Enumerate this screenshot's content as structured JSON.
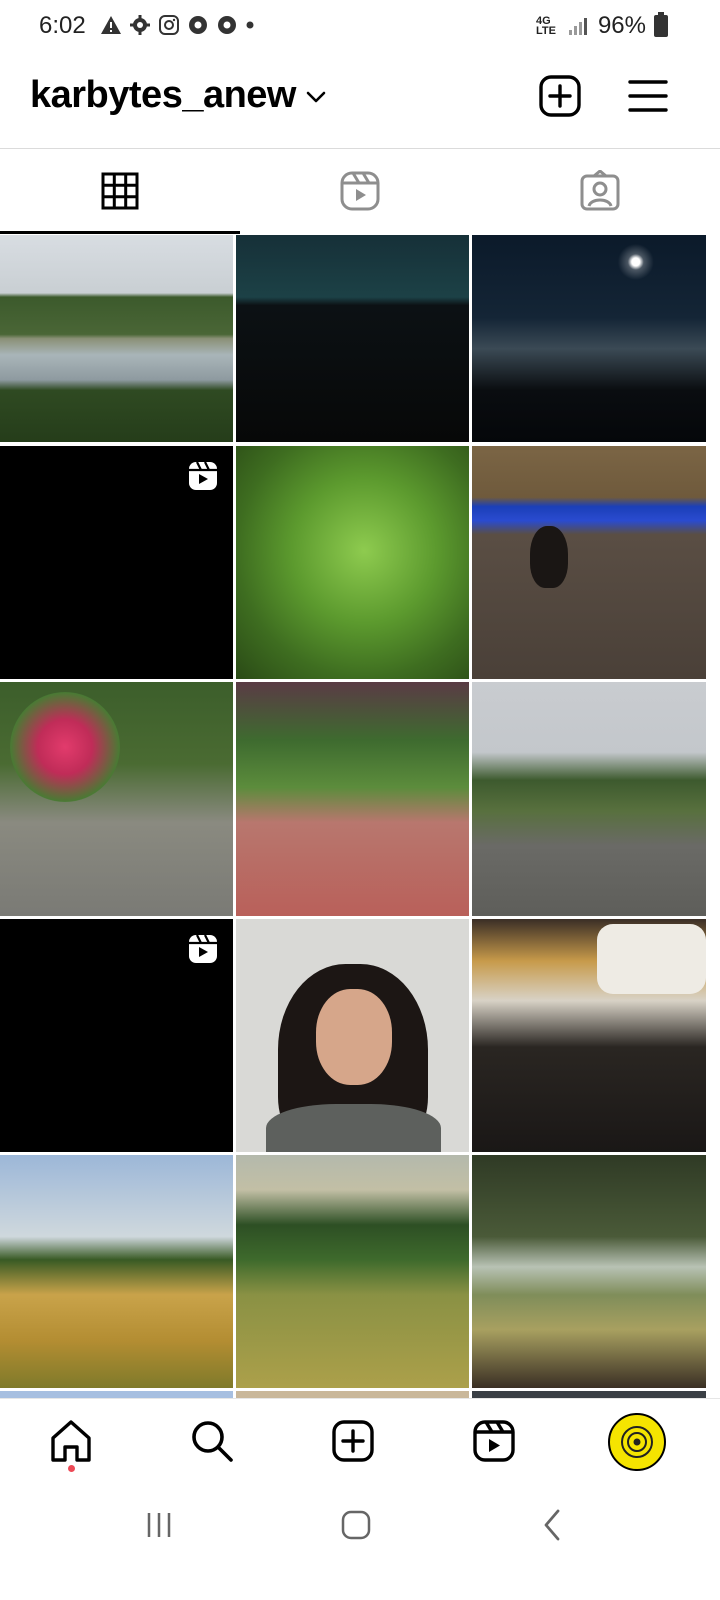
{
  "status_bar": {
    "time": "6:02",
    "network": "4G LTE",
    "battery": "96%",
    "icons": [
      "alert-icon",
      "settings-icon",
      "instagram-icon",
      "chrome-icon",
      "chrome-icon",
      "dot-icon"
    ]
  },
  "header": {
    "username": "karbytes_anew",
    "actions": [
      "create-post-icon",
      "menu-icon"
    ]
  },
  "tabs": [
    {
      "name": "grid-tab",
      "icon": "grid-icon",
      "active": true
    },
    {
      "name": "reels-tab",
      "icon": "reels-icon",
      "active": false
    },
    {
      "name": "tagged-tab",
      "icon": "tagged-icon",
      "active": false
    }
  ],
  "grid_posts": [
    {
      "name": "post-lake",
      "type": "photo"
    },
    {
      "name": "post-night-hills",
      "type": "photo"
    },
    {
      "name": "post-moon-night",
      "type": "photo"
    },
    {
      "name": "post-reel-black-1",
      "type": "reel"
    },
    {
      "name": "post-ferns",
      "type": "photo"
    },
    {
      "name": "post-cat-floor",
      "type": "photo"
    },
    {
      "name": "post-flowers-cat",
      "type": "photo"
    },
    {
      "name": "post-patio-cat",
      "type": "photo"
    },
    {
      "name": "post-street",
      "type": "photo"
    },
    {
      "name": "post-reel-black-2",
      "type": "reel"
    },
    {
      "name": "post-selfie",
      "type": "photo"
    },
    {
      "name": "post-cat-books",
      "type": "photo"
    },
    {
      "name": "post-golden-hills",
      "type": "photo"
    },
    {
      "name": "post-green-valley",
      "type": "photo"
    },
    {
      "name": "post-tree-canopy",
      "type": "photo"
    }
  ],
  "bottom_nav": [
    "home-icon",
    "search-icon",
    "create-icon",
    "reels-icon",
    "profile-avatar"
  ],
  "colors": {
    "accent_dot": "#ed4956",
    "avatar_bg": "#f5e400"
  }
}
